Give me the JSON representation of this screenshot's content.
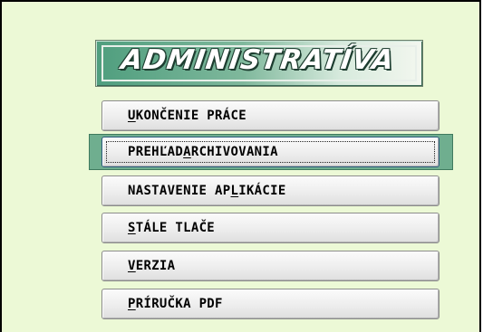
{
  "title": "ADMINISTRATÍVA",
  "menu": [
    {
      "pre": "",
      "hot": "U",
      "post": "KONČENIE PRÁCE",
      "active": false
    },
    {
      "pre": "PREHĽAD ",
      "hot": "A",
      "post": "RCHIVOVANIA",
      "active": true
    },
    {
      "pre": "NASTAVENIE AP",
      "hot": "L",
      "post": "IKÁCIE",
      "active": false
    },
    {
      "pre": "",
      "hot": "S",
      "post": "TÁLE TLAČE",
      "active": false
    },
    {
      "pre": "",
      "hot": "V",
      "post": "ERZIA",
      "active": false
    },
    {
      "pre": "",
      "hot": "P",
      "post": "RÍRUČKA PDF",
      "active": false
    }
  ],
  "colors": {
    "background": "#ecf9d6",
    "highlight": "#6fae8f",
    "title_gradient_start": "#4f9e7e"
  }
}
